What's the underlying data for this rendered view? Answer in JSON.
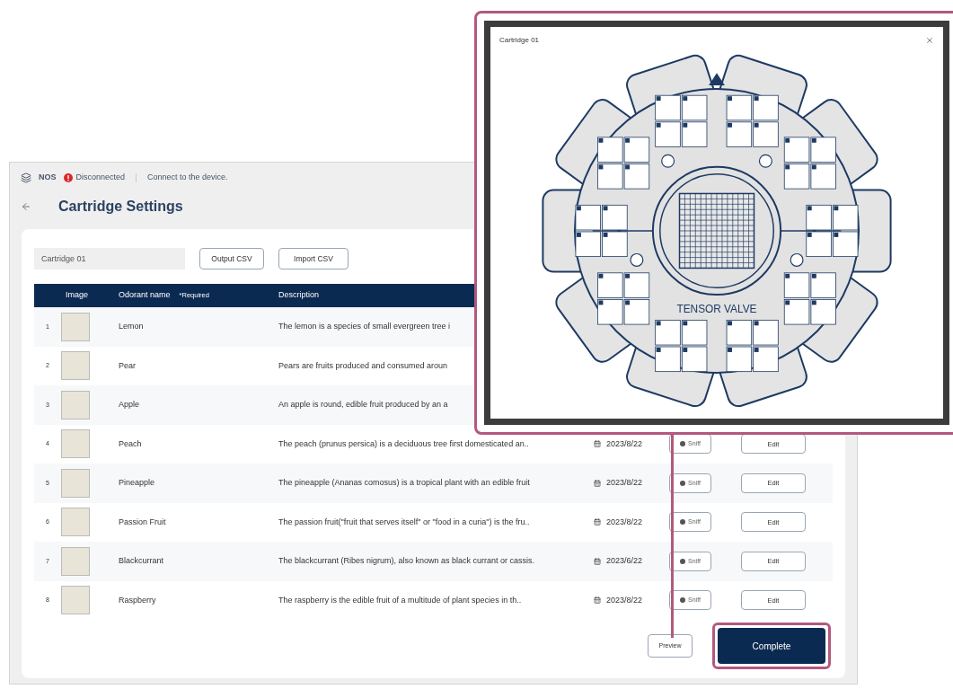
{
  "status_bar": {
    "device": "NOS",
    "connected": false,
    "connection": "Disconnected",
    "message": "Connect to the device."
  },
  "page_title": "Cartridge Settings",
  "cartridge_name": "Cartridge 01",
  "buttons": {
    "export": "Output CSV",
    "import": "Import CSV",
    "preview": "Preview",
    "complete": "Complete"
  },
  "table": {
    "columns": {
      "image": "Image",
      "name": "Odorant name",
      "required": "*Required",
      "description": "Description"
    },
    "rows": [
      {
        "index": "1",
        "name": "Lemon",
        "description": "The lemon is a species of small evergreen tree i"
      },
      {
        "index": "2",
        "name": "Pear",
        "description": "Pears are fruits produced and consumed aroun"
      },
      {
        "index": "3",
        "name": "Apple",
        "description": "An apple is round, edible fruit produced by an a"
      },
      {
        "index": "4",
        "name": "Peach",
        "description": "The peach (prunus persica) is a deciduous tree first domesticated an..",
        "date": "2023/8/22",
        "sniff": "Sniff",
        "edit": "Edit"
      },
      {
        "index": "5",
        "name": "Pineapple",
        "description": "The pineapple (Ananas comosus) is a tropical plant with an edible fruit",
        "date": "2023/8/22",
        "sniff": "Sniff",
        "edit": "Edit"
      },
      {
        "index": "6",
        "name": "Passion Fruit",
        "description": "The passion fruit(\"fruit that serves itself\" or \"food in a curia\") is the fru..",
        "date": "2023/8/22",
        "sniff": "Sniff",
        "edit": "Edit"
      },
      {
        "index": "7",
        "name": "Blackcurrant",
        "description": "The blackcurrant (Ribes nigrum), also known as black currant or cassis.",
        "date": "2023/6/22",
        "sniff": "Sniff",
        "edit": "Edit"
      },
      {
        "index": "8",
        "name": "Raspberry",
        "description": "The raspberry is the edible fruit of a multitude of plant species in th..",
        "date": "2023/8/22",
        "sniff": "Sniff",
        "edit": "Edit"
      }
    ]
  },
  "popup": {
    "title": "Cartridge 01",
    "center_label": "TENSOR VALVE"
  }
}
